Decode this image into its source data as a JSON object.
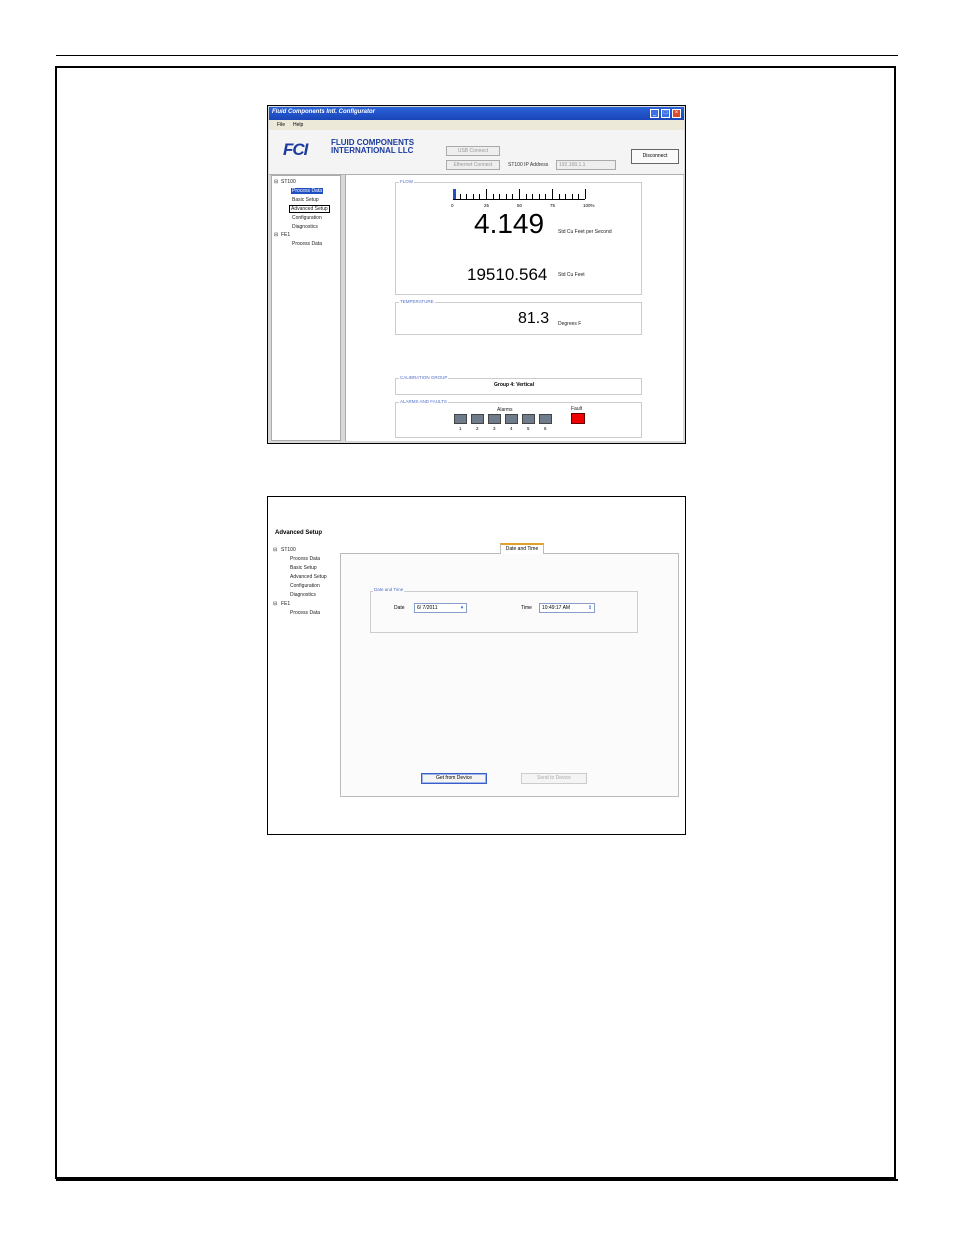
{
  "app": {
    "window_title": "Fluid Components Intl. Configurator",
    "menu": [
      "File",
      "Help"
    ],
    "logo_mark": "FCI",
    "logo_line1": "FLUID COMPONENTS",
    "logo_line2": "INTERNATIONAL LLC",
    "usb_connect": "USB Connect",
    "ethernet_connect": "Ethernet Connect",
    "ip_label": "ST100 IP Address",
    "ip_value": "192.168.1.1",
    "disconnect": "Disconnect"
  },
  "tree": {
    "root1": "ST100",
    "items": [
      "Process Data",
      "Basic Setup",
      "Advanced Setup",
      "Configuration",
      "Diagnostics"
    ],
    "root2": "FE1",
    "fe_item": "Process Data"
  },
  "flow": {
    "label": "FLOW",
    "scale_ticks": [
      "0",
      "25",
      "50",
      "75",
      "100%"
    ],
    "level_percent": 1,
    "rate_value": "4.149",
    "rate_unit": "Std Cu Feet per Second",
    "total_value": "19510.564",
    "total_unit": "Std Cu Feet"
  },
  "temperature": {
    "label": "TEMPERATURE",
    "value": "81.3",
    "unit": "Degrees F"
  },
  "calibration": {
    "label": "CALIBRATION GROUP",
    "value": "Group 4: Vertical"
  },
  "alarms": {
    "label": "ALARMS AND FAULTS",
    "alarms_title": "Alarms",
    "fault_title": "Fault",
    "numbers": [
      "1",
      "2",
      "3",
      "4",
      "5",
      "6"
    ],
    "alarm_color": "#6f7c8c",
    "fault_color": "#ee0000"
  },
  "advanced": {
    "title": "Advanced Setup",
    "tree_root1": "ST100",
    "tree_items": [
      "Process Data",
      "Basic Setup",
      "Advanced Setup",
      "Configuration",
      "Diagnostics"
    ],
    "tree_root2": "FE1",
    "tree_fe_item": "Process Data",
    "tab": "Date and Time",
    "group_label": "Date and Time",
    "date_label": "Date",
    "date_value": "6/ 7/2011",
    "time_label": "Time",
    "time_value": "10:49:17 AM",
    "get_button": "Get from Device",
    "send_button": "Send to Device"
  }
}
